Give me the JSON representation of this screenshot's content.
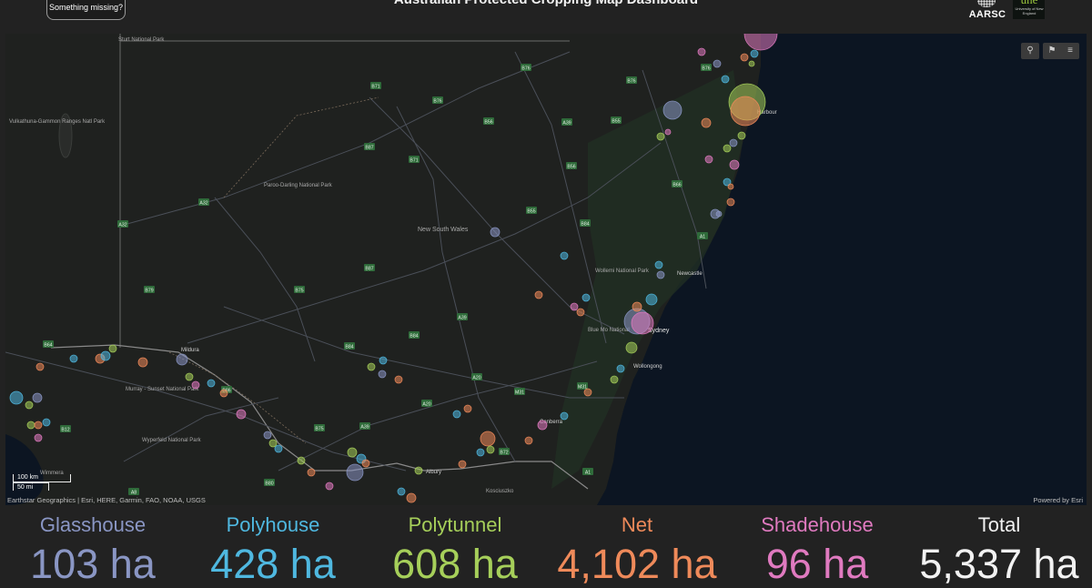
{
  "header": {
    "title": "Australian Protected Cropping Map Dashboard",
    "feedback_button": "Something missing?",
    "logo_aarsc": "AARSC",
    "logo_une_mark": "une",
    "logo_une_text": "University of New England"
  },
  "map": {
    "attribution": "Earthstar Geographics | Esri, HERE, Garmin, FAO, NOAA, USGS",
    "powered_by": "Powered by Esri",
    "scale_km": "100 km",
    "scale_mi": "50 mi",
    "tools": {
      "search_icon": "search-icon",
      "bookmark_icon": "bookmark-icon",
      "legend_icon": "legend-list-icon"
    },
    "place_labels": {
      "new_south_wales": "New South Wales",
      "sturt": "Sturt National Park",
      "vulkathuna": "Vulkathuna-Gammon Ranges Natl Park",
      "paroo": "Paroo-Darling National Park",
      "wollemi": "Wollemi National Park",
      "newcastle": "Newcastle",
      "sydney": "Sydney",
      "wollongong": "Wollongong",
      "canberra": "Canberra",
      "albury": "Albury",
      "mildura": "Mildura",
      "murray_sunset": "Murray - Sunset National Park",
      "wyperfeld": "Wyperfeld National Park",
      "kosciuszko": "Kosciuszko",
      "coffs_harbour": "Harbour",
      "blue_mountains": "Blue Mo National",
      "wimmera": "Wimmera"
    },
    "roads": [
      "B76",
      "B76",
      "B76",
      "B71",
      "B76",
      "B56",
      "A39",
      "B55",
      "B87",
      "B71",
      "B56",
      "B66",
      "A32",
      "A32",
      "B55",
      "B84",
      "A1",
      "B87",
      "B79",
      "B75",
      "A39",
      "B84",
      "B84",
      "A20",
      "M31",
      "M31",
      "B75",
      "A39",
      "A20",
      "B72",
      "A1",
      "B86",
      "B64",
      "B12",
      "A8",
      "B80",
      "B75"
    ]
  },
  "colors": {
    "glasshouse": "#8a96c4",
    "polyhouse": "#4fb8e0",
    "polytunnel": "#a6cf5a",
    "net": "#ef8a5a",
    "shadehouse": "#e07ac0",
    "total": "#f2f2f2",
    "ocean": "#0c1522",
    "land": "#1f211f"
  },
  "stats": [
    {
      "label": "Glasshouse",
      "value": "103 ha"
    },
    {
      "label": "Polyhouse",
      "value": "428 ha"
    },
    {
      "label": "Polytunnel",
      "value": "608 ha"
    },
    {
      "label": "Net",
      "value": "4,102 ha"
    },
    {
      "label": "Shadehouse",
      "value": "96 ha"
    },
    {
      "label": "Total",
      "value": "5,337 ha"
    }
  ]
}
